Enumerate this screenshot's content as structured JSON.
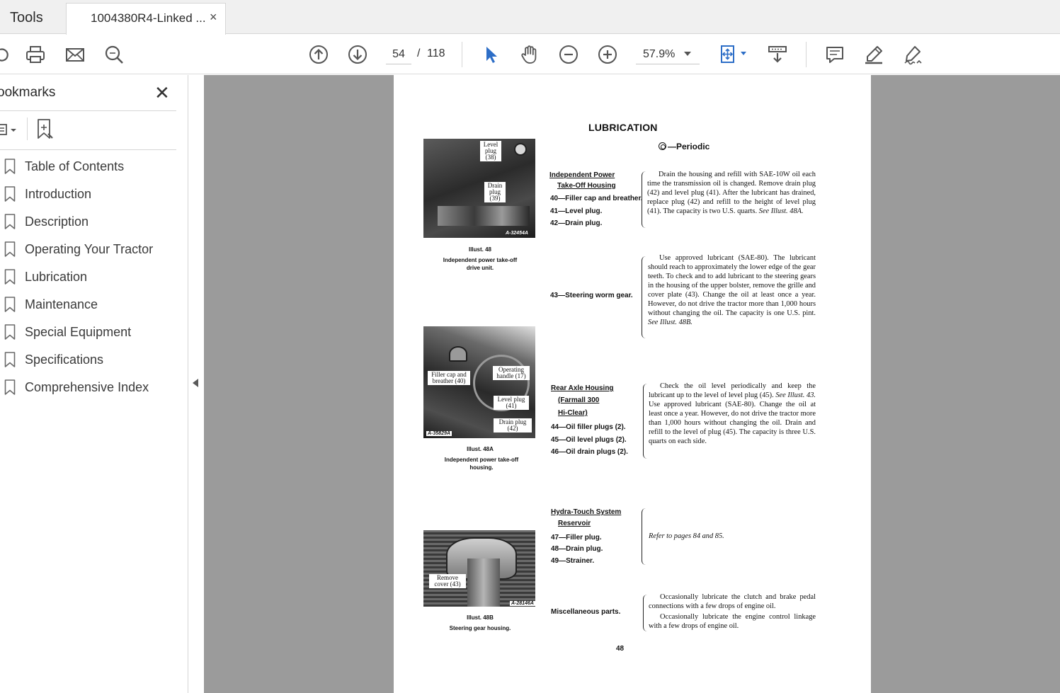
{
  "tabs": {
    "tools_label": "Tools",
    "document_title": "1004380R4-Linked ...",
    "close_glyph": "×"
  },
  "toolbar": {
    "current_page": "54",
    "page_separator": "/",
    "total_pages": "118",
    "zoom": "57.9%",
    "icons": [
      "send-file-icon",
      "print-icon",
      "email-icon",
      "search-icon",
      "previous-page-icon",
      "next-page-icon",
      "select-pointer-icon",
      "hand-tool-icon",
      "zoom-out-icon",
      "zoom-in-icon",
      "fit-page-icon",
      "scroll-mode-icon",
      "comment-icon",
      "highlight-icon",
      "sign-icon"
    ],
    "accent_color": "#2d6ec7"
  },
  "bookmarks": {
    "title": "ookmarks",
    "close_glyph": "✕",
    "items": [
      {
        "label": "Table of Contents"
      },
      {
        "label": "Introduction"
      },
      {
        "label": "Description"
      },
      {
        "label": "Operating Your Tractor"
      },
      {
        "label": "Lubrication"
      },
      {
        "label": "Maintenance"
      },
      {
        "label": "Special Equipment"
      },
      {
        "label": "Specifications"
      },
      {
        "label": "Comprehensive Index"
      }
    ]
  },
  "document": {
    "title": "LUBRICATION",
    "periodic": "—Periodic",
    "page_number": "48",
    "illustrations": [
      {
        "labels": [
          "Level plug (38)",
          "Drain plug (39)"
        ],
        "code": "A-32454A",
        "illust": "Illust. 48",
        "caption": "Independent power take-off drive unit."
      },
      {
        "labels": [
          "Filler cap and breather (40)",
          "Operating handle (17)",
          "Level plug (41)",
          "Drain plug (42)"
        ],
        "code": "A-35829A",
        "illust": "Illust. 48A",
        "caption": "Independent power take-off housing."
      },
      {
        "labels": [
          "Remove cover (43)"
        ],
        "code": "A-28146A",
        "illust": "Illust. 48B",
        "caption": "Steering gear housing."
      }
    ],
    "sections": [
      {
        "heading": [
          "Independent Power",
          "Take-Off Housing"
        ],
        "items": [
          "40—Filler cap and breather.",
          "41—Level plug.",
          "42—Drain plug."
        ],
        "text": "Drain the housing and refill with SAE-10W oil each time the transmission oil is changed. Remove drain plug (42) and level plug (41). After the lubricant has drained, replace plug (42) and refill to the height of level plug (41). The capacity is two U.S. quarts.",
        "ref": "See Illust. 48A."
      },
      {
        "heading": [],
        "items": [
          "43—Steering worm gear."
        ],
        "text": "Use approved lubricant (SAE-80). The lubricant should reach to approximately the lower edge of the gear teeth. To check and to add lubricant to the steering gears in the housing of the upper bolster, remove the grille and cover plate (43). Change the oil at least once a year. However, do not drive the tractor more than 1,000 hours without changing the oil. The capacity is one U.S. pint.",
        "ref": "See Illust. 48B."
      },
      {
        "heading": [
          "Rear Axle Housing",
          "(Farmall 300",
          "Hi-Clear)"
        ],
        "items": [
          "44—Oil filler plugs (2).",
          "45—Oil level plugs (2).",
          "46—Oil drain plugs (2)."
        ],
        "text_a": "Check the oil level periodically and keep the lubricant up to the level of level plug (45).",
        "ref": "See Illust. 43.",
        "text_b": "Use approved lubricant (SAE-80). Change the oil at least once a year. However, do not drive the tractor more than 1,000 hours without changing the oil. Drain and refill to the level of plug (45). The capacity is three U.S. quarts on each side."
      },
      {
        "heading": [
          "Hydra-Touch System",
          "Reservoir"
        ],
        "items": [
          "47—Filler plug.",
          "48—Drain plug.",
          "49—Strainer."
        ],
        "ref_text": "Refer to pages 84 and 85."
      },
      {
        "heading": [],
        "items": [
          "Miscellaneous parts."
        ],
        "text_a": "Occasionally lubricate the clutch and brake pedal connections with a few drops of engine oil.",
        "text_b": "Occasionally lubricate the engine control linkage with a few drops of engine oil."
      }
    ]
  }
}
